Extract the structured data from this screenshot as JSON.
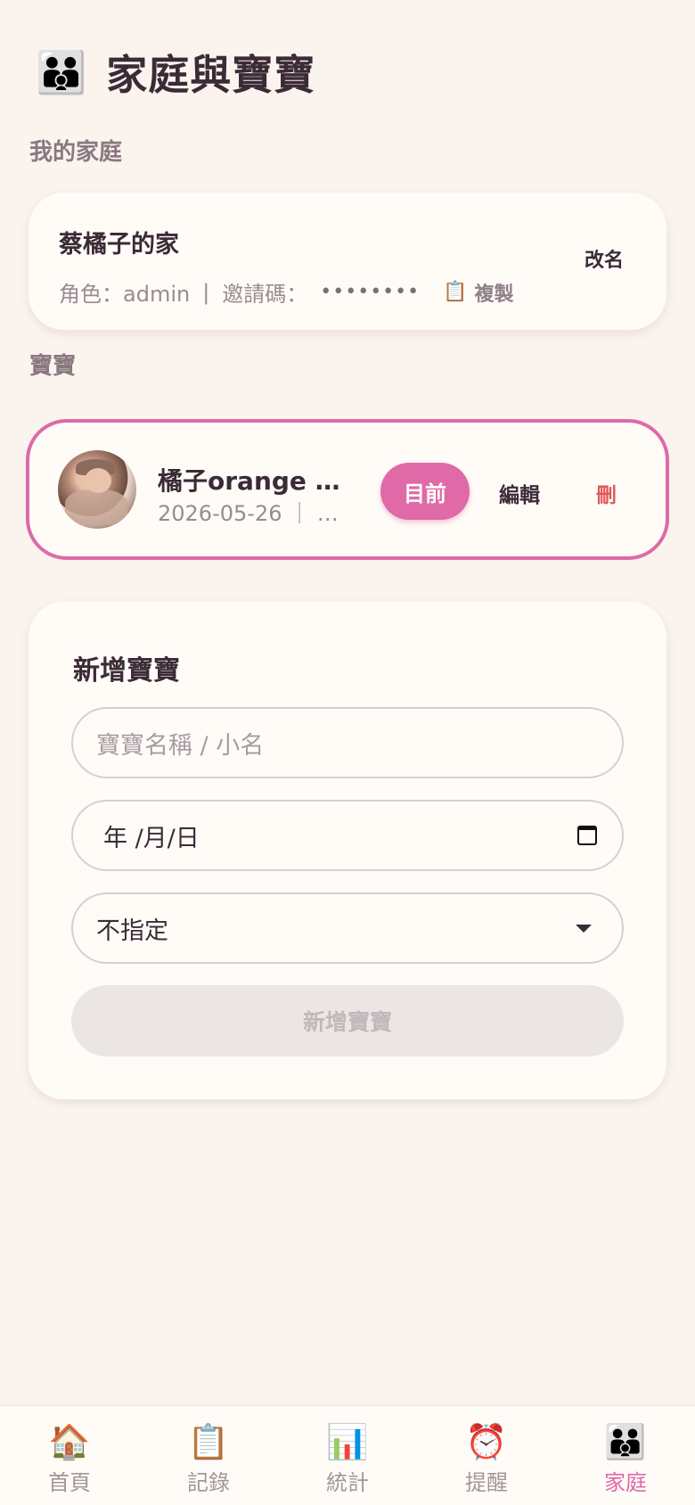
{
  "header": {
    "icon": "family-icon",
    "emoji": "👪",
    "title": "家庭與寶寶"
  },
  "sections": {
    "family_label": "我的家庭",
    "babies_label": "寶寶"
  },
  "family": {
    "name": "蔡橘子的家",
    "role_text": "角色：admin",
    "separator": "|",
    "invite_label": "邀請碼：",
    "invite_code_masked": "••••••••",
    "copy_icon": "📋",
    "copy_label": "複製",
    "rename_label": "改名"
  },
  "baby": {
    "name": "橘子orange 🍊 …",
    "meta": "2026-05-26 ｜ 蔡…",
    "current_label": "目前",
    "edit_label": "編輯",
    "delete_label": "刪"
  },
  "add_form": {
    "title": "新增寶寶",
    "name_placeholder": "寶寶名稱 / 小名",
    "date_value": "年 /月/日",
    "gender_value": "不指定",
    "submit_label": "新增寶寶"
  },
  "nav": [
    {
      "icon": "home-icon",
      "emoji": "🏠",
      "label": "首頁"
    },
    {
      "icon": "clipboard-icon",
      "emoji": "📋",
      "label": "記錄"
    },
    {
      "icon": "chart-icon",
      "emoji": "📊",
      "label": "統計"
    },
    {
      "icon": "alarm-clock-icon",
      "emoji": "⏰",
      "label": "提醒"
    },
    {
      "icon": "family-icon",
      "emoji": "👪",
      "label": "家庭",
      "active": true
    }
  ],
  "colors": {
    "accent": "#df6aa7",
    "background": "#faf3ee",
    "danger": "#e05656"
  }
}
